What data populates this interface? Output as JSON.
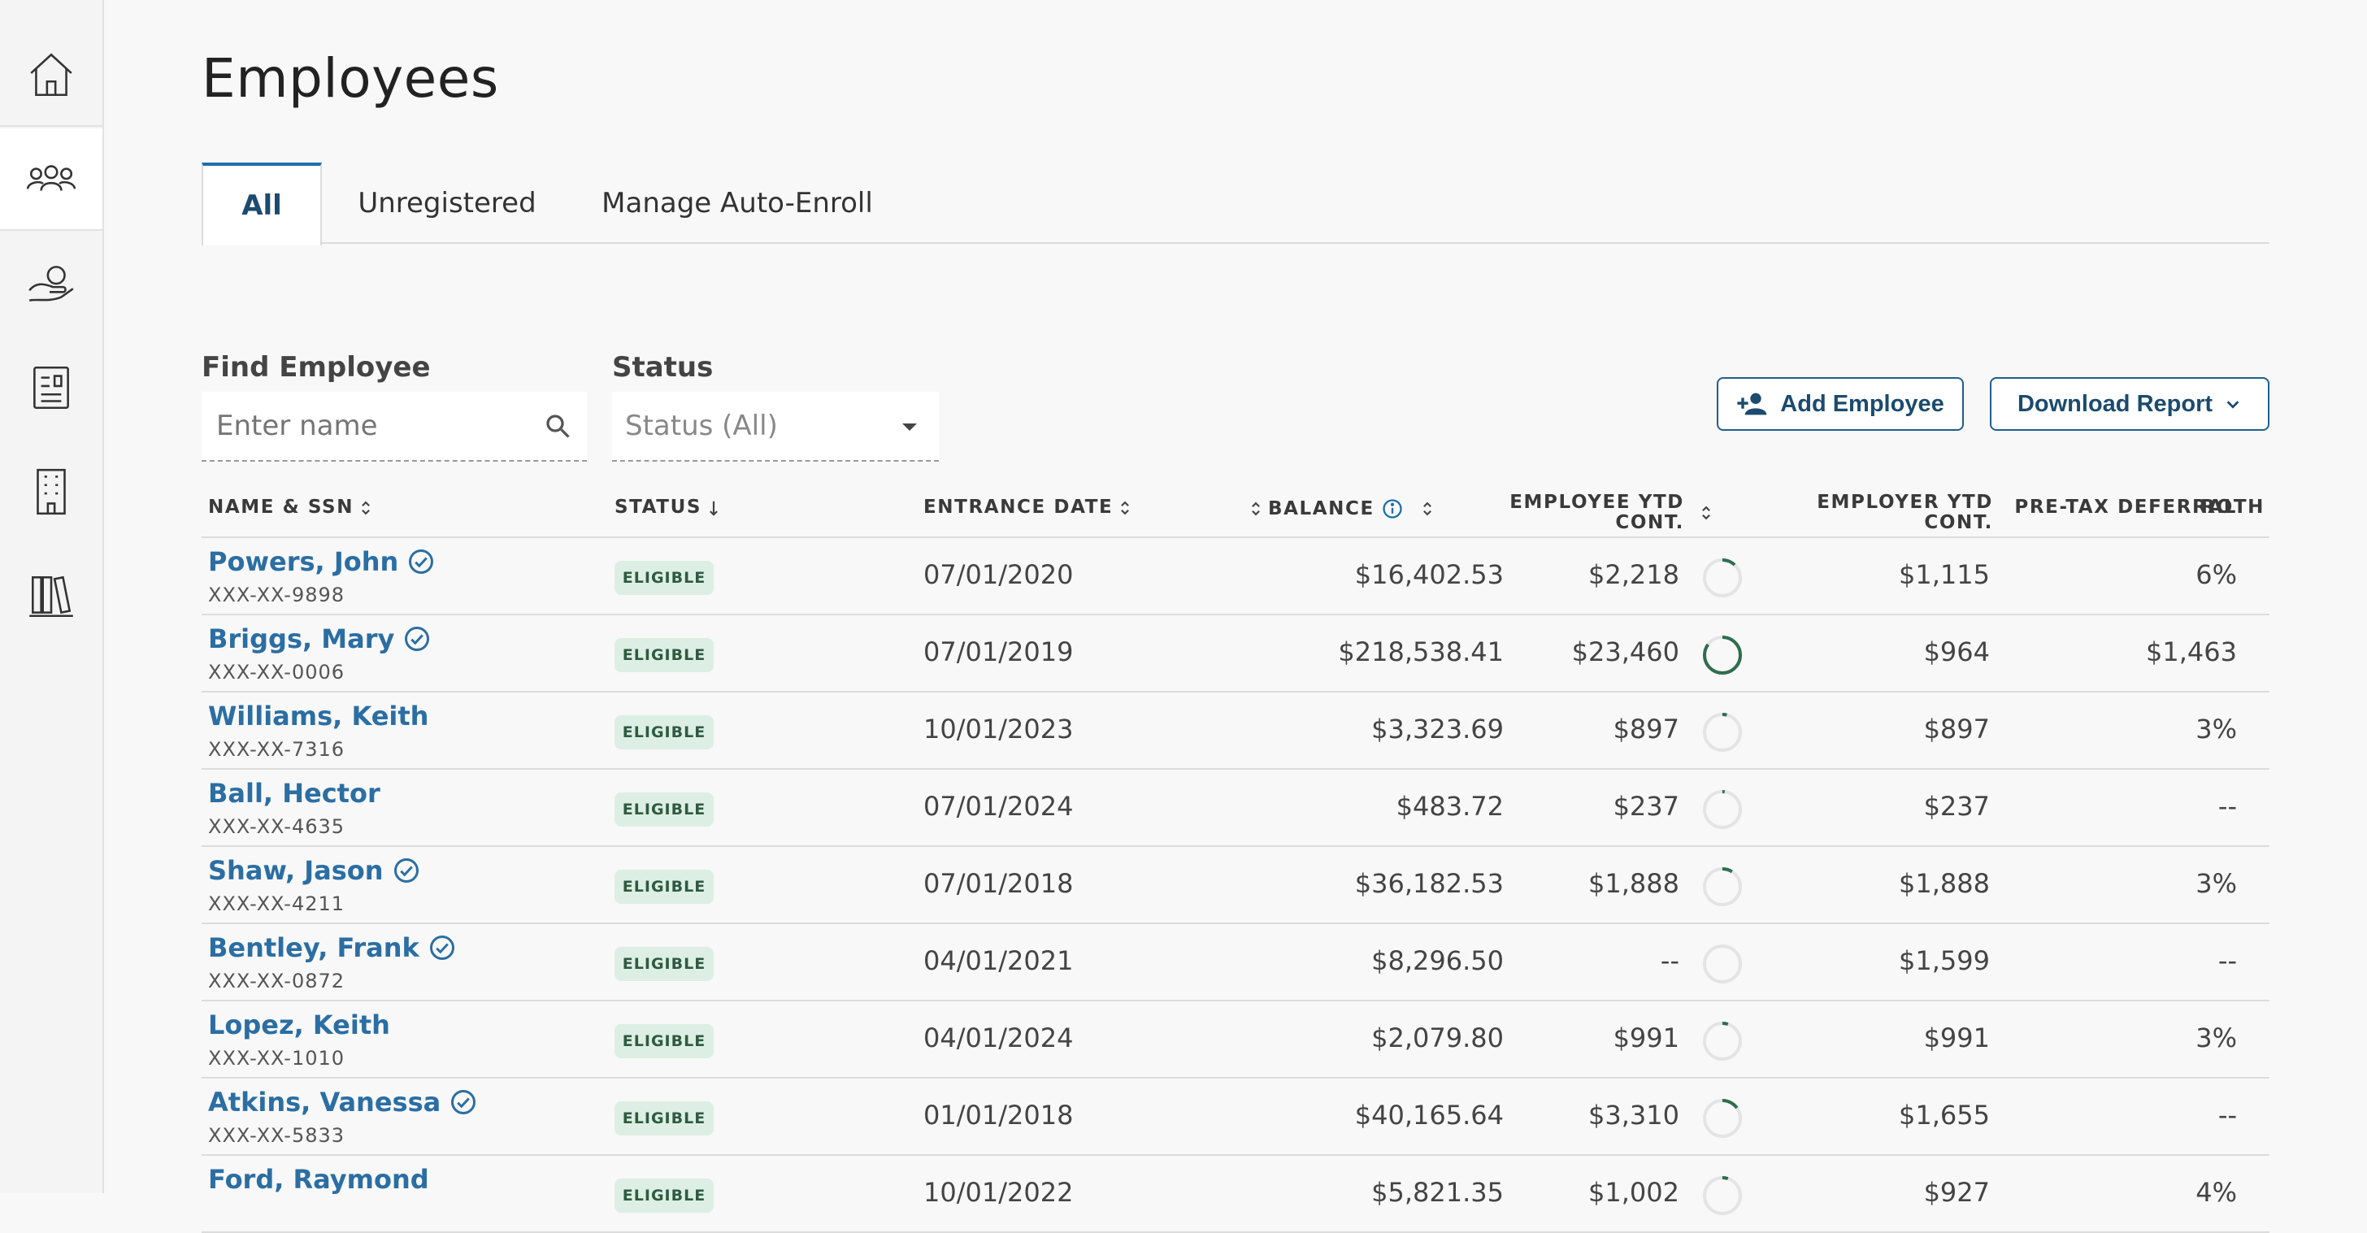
{
  "page": {
    "title": "Employees"
  },
  "tabs": [
    {
      "label": "All",
      "active": true
    },
    {
      "label": "Unregistered",
      "active": false
    },
    {
      "label": "Manage Auto-Enroll",
      "active": false
    }
  ],
  "filters": {
    "find_label": "Find Employee",
    "find_placeholder": "Enter name",
    "status_label": "Status",
    "status_value": "Status (All)"
  },
  "actions": {
    "add_employee": "Add Employee",
    "download_report": "Download Report"
  },
  "table": {
    "headers": {
      "name": "NAME & SSN",
      "status": "STATUS",
      "entrance": "ENTRANCE DATE",
      "balance": "BALANCE",
      "emp_ytd_1": "EMPLOYEE YTD",
      "emp_ytd_2": "CONT.",
      "er_ytd_1": "EMPLOYER YTD",
      "er_ytd_2": "CONT.",
      "pretax": "PRE-TAX DEFERRAL",
      "roth": "ROTH"
    },
    "rows": [
      {
        "name": "Powers, John",
        "verified": true,
        "ssn": "XXX-XX-9898",
        "status": "ELIGIBLE",
        "entrance": "07/01/2020",
        "balance": "$16,402.53",
        "emp_ytd": "$2,218",
        "progress": 0.12,
        "er_ytd": "$1,115",
        "pretax": "6%"
      },
      {
        "name": "Briggs, Mary",
        "verified": true,
        "ssn": "XXX-XX-0006",
        "status": "ELIGIBLE",
        "entrance": "07/01/2019",
        "balance": "$218,538.41",
        "emp_ytd": "$23,460",
        "progress": 0.85,
        "er_ytd": "$964",
        "pretax": "$1,463"
      },
      {
        "name": "Williams, Keith",
        "verified": false,
        "ssn": "XXX-XX-7316",
        "status": "ELIGIBLE",
        "entrance": "10/01/2023",
        "balance": "$3,323.69",
        "emp_ytd": "$897",
        "progress": 0.04,
        "er_ytd": "$897",
        "pretax": "3%"
      },
      {
        "name": "Ball, Hector",
        "verified": false,
        "ssn": "XXX-XX-4635",
        "status": "ELIGIBLE",
        "entrance": "07/01/2024",
        "balance": "$483.72",
        "emp_ytd": "$237",
        "progress": 0.02,
        "er_ytd": "$237",
        "pretax": "--"
      },
      {
        "name": "Shaw, Jason",
        "verified": true,
        "ssn": "XXX-XX-4211",
        "status": "ELIGIBLE",
        "entrance": "07/01/2018",
        "balance": "$36,182.53",
        "emp_ytd": "$1,888",
        "progress": 0.09,
        "er_ytd": "$1,888",
        "pretax": "3%"
      },
      {
        "name": "Bentley, Frank",
        "verified": true,
        "ssn": "XXX-XX-0872",
        "status": "ELIGIBLE",
        "entrance": "04/01/2021",
        "balance": "$8,296.50",
        "emp_ytd": "--",
        "progress": 0.0,
        "er_ytd": "$1,599",
        "pretax": "--"
      },
      {
        "name": "Lopez, Keith",
        "verified": false,
        "ssn": "XXX-XX-1010",
        "status": "ELIGIBLE",
        "entrance": "04/01/2024",
        "balance": "$2,079.80",
        "emp_ytd": "$991",
        "progress": 0.05,
        "er_ytd": "$991",
        "pretax": "3%"
      },
      {
        "name": "Atkins, Vanessa",
        "verified": true,
        "ssn": "XXX-XX-5833",
        "status": "ELIGIBLE",
        "entrance": "01/01/2018",
        "balance": "$40,165.64",
        "emp_ytd": "$3,310",
        "progress": 0.15,
        "er_ytd": "$1,655",
        "pretax": "--"
      },
      {
        "name": "Ford, Raymond",
        "verified": false,
        "ssn": "",
        "status": "ELIGIBLE",
        "entrance": "10/01/2022",
        "balance": "$5,821.35",
        "emp_ytd": "$1,002",
        "progress": 0.05,
        "er_ytd": "$927",
        "pretax": "4%"
      }
    ]
  },
  "help": {
    "label": "?"
  },
  "colors": {
    "accent": "#1f6fa8",
    "link": "#2b6ea3",
    "badge_bg": "#ddefe4",
    "ring": "#2e6e4c",
    "help": "#e2b93b"
  }
}
